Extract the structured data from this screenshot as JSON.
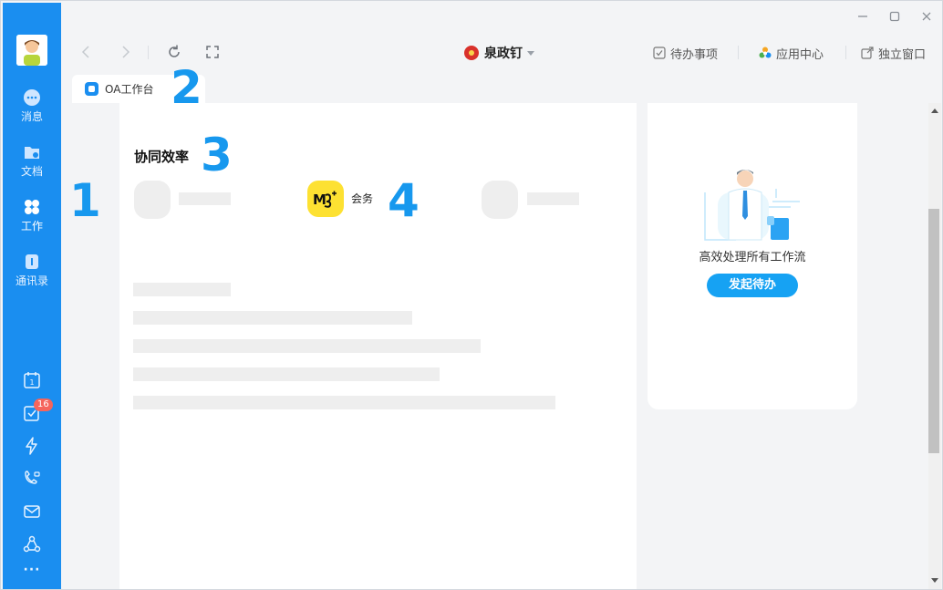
{
  "sidebar": {
    "items": [
      {
        "label": "消息",
        "icon": "message-icon"
      },
      {
        "label": "文档",
        "icon": "document-icon"
      },
      {
        "label": "工作",
        "icon": "work-icon"
      },
      {
        "label": "通讯录",
        "icon": "contacts-icon"
      }
    ],
    "todo_badge": "16",
    "more_label": "···"
  },
  "toolbar": {
    "org_name": "泉政钉",
    "todo_label": "待办事项",
    "app_center_label": "应用中心",
    "window_label": "独立窗口"
  },
  "tab": {
    "label": "OA工作台"
  },
  "main": {
    "section_title": "协同效率",
    "app_logo": "M",
    "app_name": "会务"
  },
  "promo": {
    "text": "高效处理所有工作流",
    "button": "发起待办"
  },
  "annotations": [
    "1",
    "2",
    "3",
    "4"
  ],
  "colors": {
    "sidebar": "#1a8ef0",
    "accent": "#16a2f3",
    "badge": "#f5655c",
    "app_tile": "#fde132"
  }
}
